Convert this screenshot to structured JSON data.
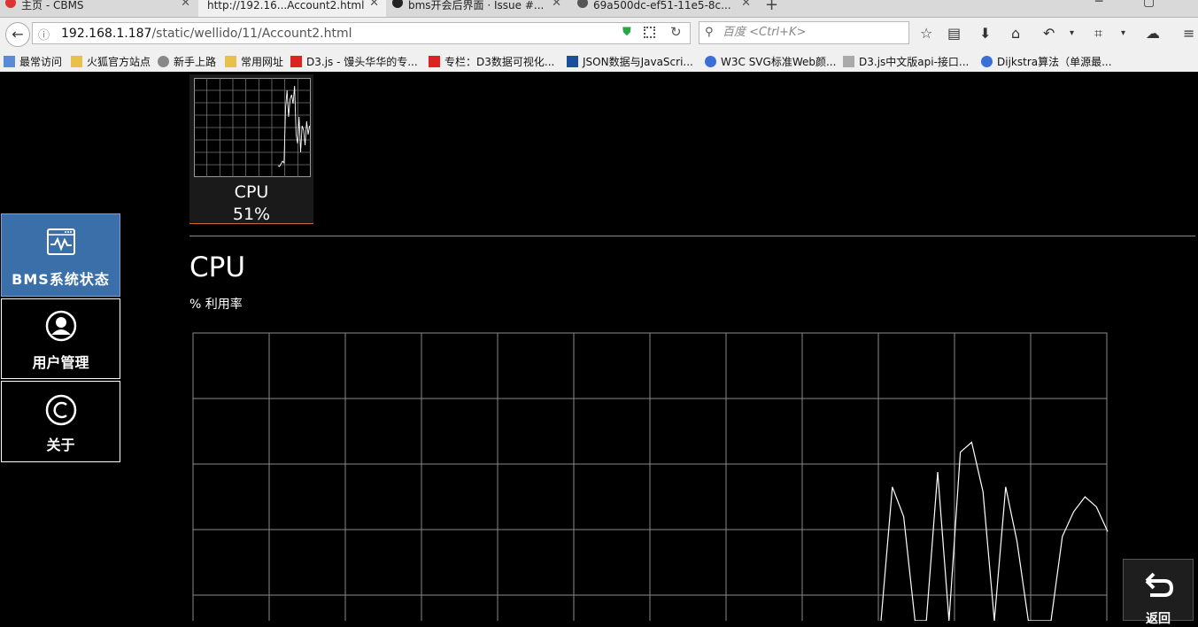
{
  "browser": {
    "tabs": [
      {
        "title": "主页 - CBMS",
        "active": false
      },
      {
        "title": "http://192.16...Account2.html",
        "active": true
      },
      {
        "title": "bms开会后界面 · Issue #...",
        "active": false
      },
      {
        "title": "69a500dc-ef51-11e5-8c...",
        "active": false
      }
    ],
    "url_host": "192.168.1.187",
    "url_path": "/static/wellido/11/Account2.html",
    "search_placeholder": "百度 <Ctrl+K>",
    "bookmarks": [
      {
        "label": "最常访问",
        "icon": "bookmark-folder-icon"
      },
      {
        "label": "火狐官方站点",
        "icon": "folder-icon"
      },
      {
        "label": "新手上路",
        "icon": "globe-icon"
      },
      {
        "label": "常用网址",
        "icon": "folder-icon"
      },
      {
        "label": "D3.js - 馒头华华的专...",
        "icon": "csdn-icon"
      },
      {
        "label": "专栏：D3数据可视化...",
        "icon": "csdn-icon"
      },
      {
        "label": "JSON数据与JavaScri...",
        "icon": "site-icon"
      },
      {
        "label": "W3C SVG标准Web颜...",
        "icon": "site-icon"
      },
      {
        "label": "D3.js中文版api-接口...",
        "icon": "edit-icon"
      },
      {
        "label": "Dijkstra算法（单源最...",
        "icon": "site-icon"
      }
    ]
  },
  "sidebar": {
    "items": [
      {
        "label": "BMS系统状态",
        "icon": "monitor-chart-icon",
        "active": true
      },
      {
        "label": "用户管理",
        "icon": "user-icon",
        "active": false
      },
      {
        "label": "关于",
        "icon": "copyright-icon",
        "active": false
      }
    ]
  },
  "mini_card": {
    "label": "CPU",
    "value": "51%"
  },
  "main": {
    "title": "CPU",
    "subtitle": "% 利用率"
  },
  "back_button": {
    "label": "返回"
  },
  "colors": {
    "accent": "#3b6fa9",
    "background": "#000000",
    "grid": "#8a8a8a",
    "line": "#ffffff"
  },
  "chart_data": {
    "type": "line",
    "title": "",
    "xlabel": "",
    "ylabel": "",
    "ylim": [
      0,
      100
    ],
    "grid": true,
    "x": [
      0,
      60,
      84,
      88,
      93,
      98,
      112,
      116,
      127,
      133,
      137,
      152,
      165,
      181,
      186,
      192,
      204,
      209,
      214,
      220,
      236,
      254,
      270,
      276
    ],
    "series": [
      {
        "name": "",
        "values": [
          0,
          0,
          0,
          0,
          0,
          0,
          0,
          0,
          0,
          0,
          0,
          0,
          0,
          0,
          0,
          0,
          0,
          0,
          0,
          0,
          0,
          0,
          0,
          0
        ]
      }
    ],
    "visible_tail": {
      "x": [
        0,
        1,
        2,
        3,
        4,
        5,
        6,
        7,
        8,
        9,
        10,
        11,
        12,
        13,
        14,
        15,
        16,
        17,
        18,
        19,
        20
      ],
      "values": [
        0,
        27,
        21,
        0,
        0,
        30,
        0,
        34,
        36,
        26,
        0,
        27,
        16,
        0,
        0,
        0,
        17,
        22,
        25,
        23,
        18
      ]
    }
  }
}
